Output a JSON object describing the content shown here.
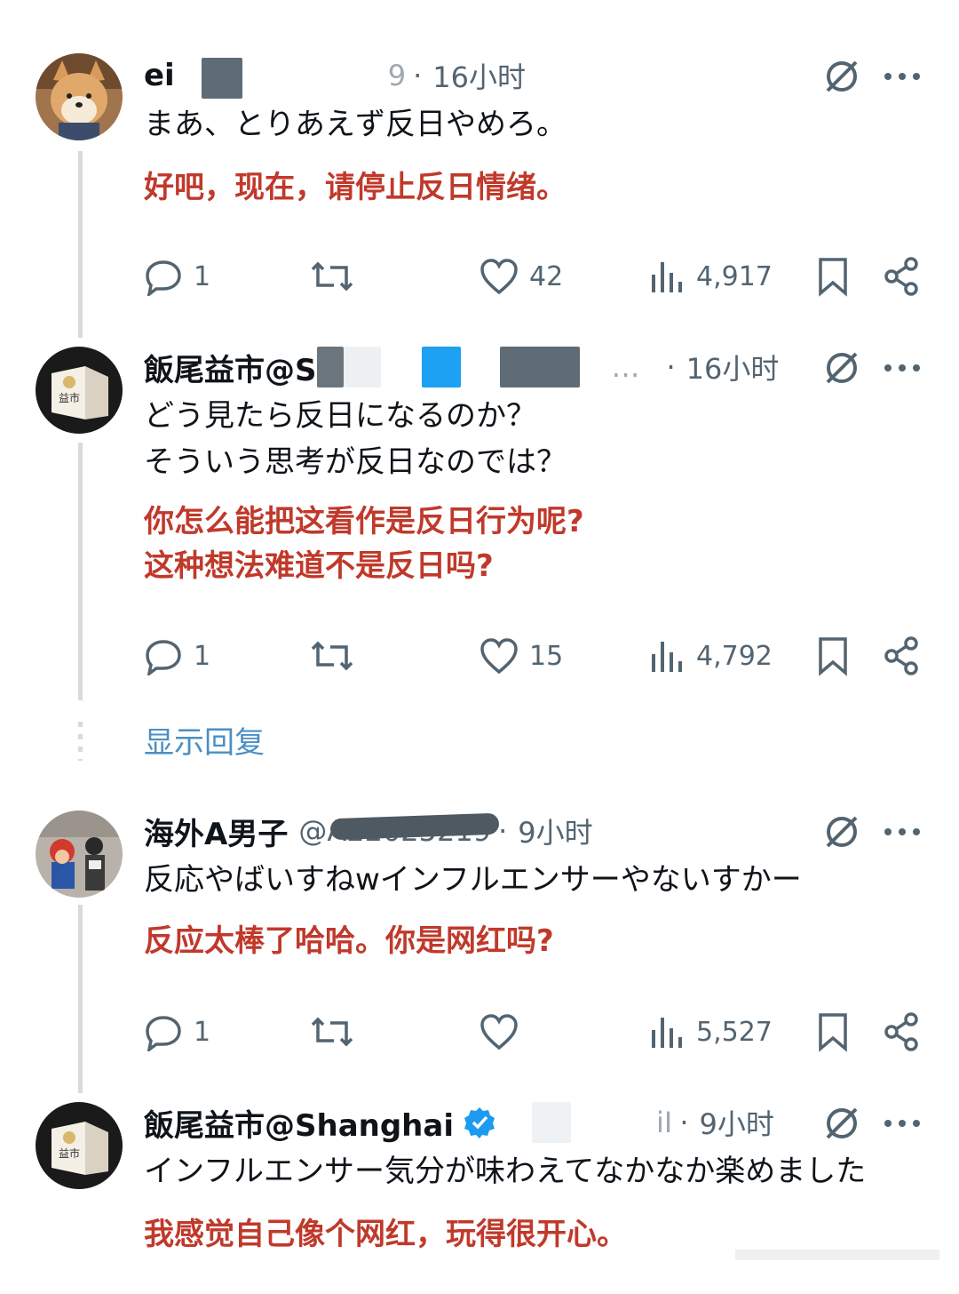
{
  "show_replies_label": "显示回复",
  "tweets": [
    {
      "name": "ei",
      "handle_tail": "9",
      "dot": "·",
      "time": "16小时",
      "text_ja": "まあ、とりあえず反日やめろ。",
      "text_zh": "好吧，现在，请停止反日情绪。",
      "replies": "1",
      "retweets": "",
      "likes": "42",
      "views": "4,917"
    },
    {
      "name": "飯尾益市@S",
      "handle_tail": "…",
      "dot": "·",
      "time": "16小时",
      "text_ja": "どう見たら反日になるのか？\nそういう思考が反日なのでは？",
      "text_zh": "你怎么能把这看作是反日行为呢?\n这种想法难道不是反日吗?",
      "replies": "1",
      "retweets": "",
      "likes": "15",
      "views": "4,792"
    },
    {
      "name": "海外A男子",
      "handle": "@A22025219",
      "dot": "·",
      "time": "9小时",
      "text_ja": "反応やばいすねwインフルエンサーやないすかー",
      "text_zh": "反应太棒了哈哈。你是网红吗?",
      "replies": "1",
      "retweets": "",
      "likes": "",
      "views": "5,527"
    },
    {
      "name": "飯尾益市@Shanghai",
      "handle_tail": "iI",
      "dot": "·",
      "time": "9小时",
      "text_ja": "インフルエンサー気分が味わえてなかなか楽めました",
      "text_zh": "我感觉自己像个网红，玩得很开心。"
    }
  ],
  "colors": {
    "translation": "#c0392b",
    "link": "#4a8fc4",
    "verified": "#1d9bf0",
    "secondary": "#536471"
  },
  "icons": [
    "reply-icon",
    "retweet-icon",
    "like-icon",
    "views-icon",
    "bookmark-icon",
    "share-icon",
    "grok-icon",
    "more-icon",
    "verified-badge-icon"
  ]
}
